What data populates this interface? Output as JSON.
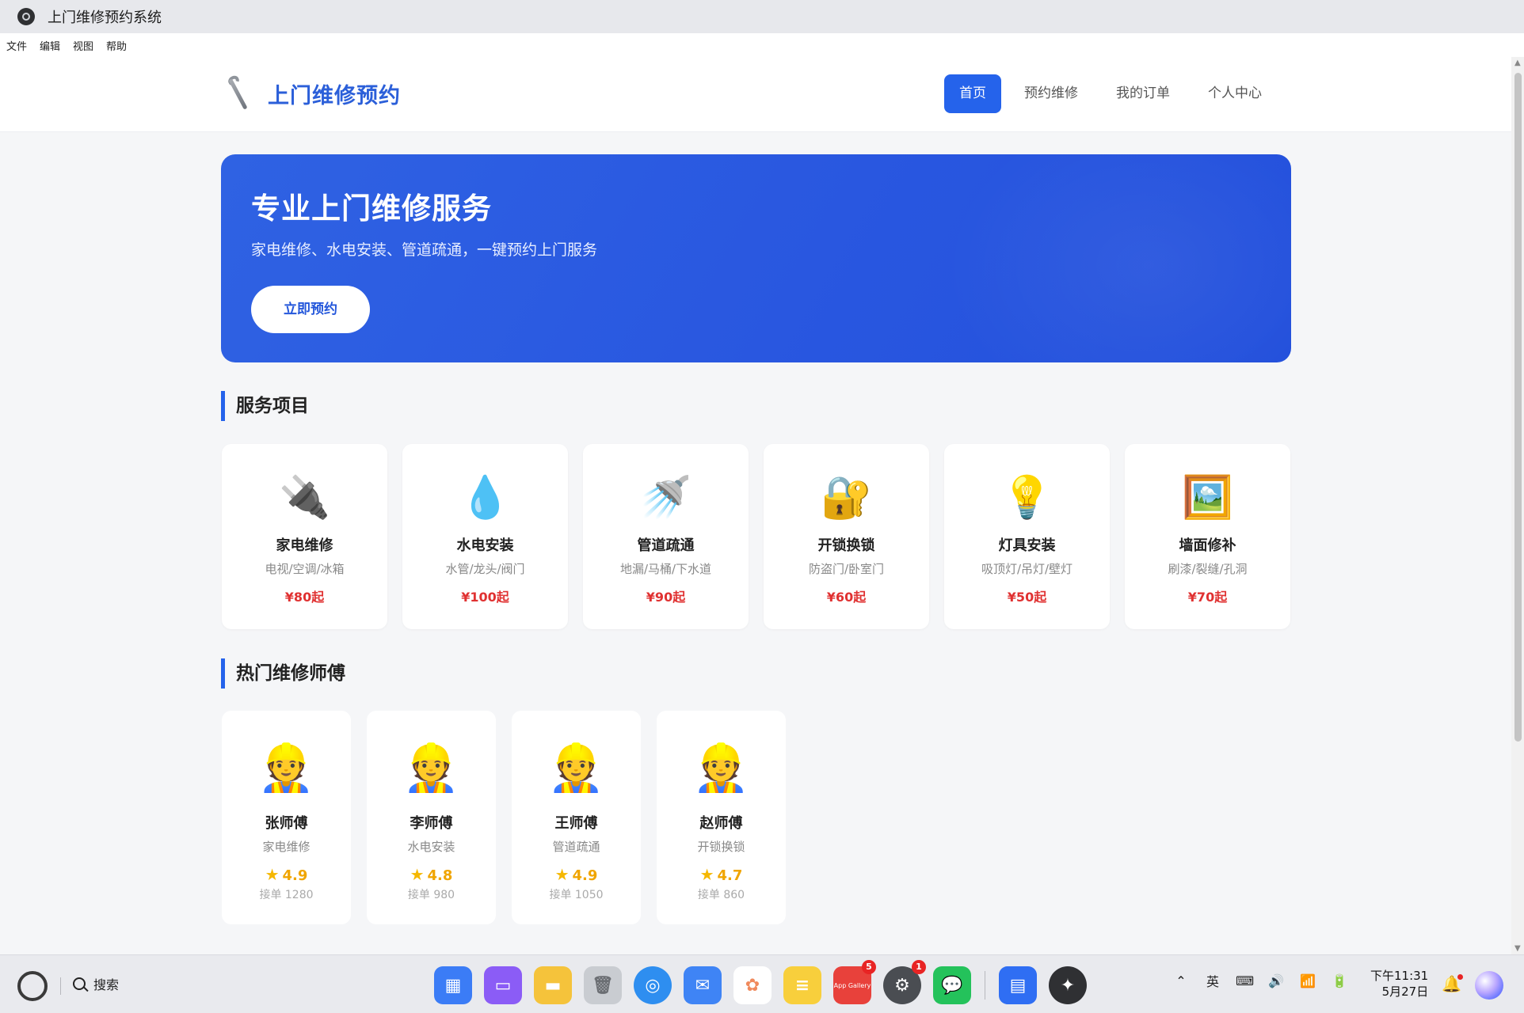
{
  "window": {
    "title": "上门维修预约系统"
  },
  "menubar": [
    "文件",
    "编辑",
    "视图",
    "帮助"
  ],
  "header": {
    "brand": "上门维修预约",
    "nav": [
      "首页",
      "预约维修",
      "我的订单",
      "个人中心"
    ]
  },
  "hero": {
    "title": "专业上门维修服务",
    "subtitle": "家电维修、水电安装、管道疏通，一键预约上门服务",
    "cta": "立即预约"
  },
  "services": {
    "title": "服务项目",
    "items": [
      {
        "icon": "🔌",
        "name": "家电维修",
        "sub": "电视/空调/冰箱",
        "price": "¥80起"
      },
      {
        "icon": "💧",
        "name": "水电安装",
        "sub": "水管/龙头/阀门",
        "price": "¥100起"
      },
      {
        "icon": "🚿",
        "name": "管道疏通",
        "sub": "地漏/马桶/下水道",
        "price": "¥90起"
      },
      {
        "icon": "🔐",
        "name": "开锁换锁",
        "sub": "防盗门/卧室门",
        "price": "¥60起"
      },
      {
        "icon": "💡",
        "name": "灯具安装",
        "sub": "吸顶灯/吊灯/壁灯",
        "price": "¥50起"
      },
      {
        "icon": "🖼️",
        "name": "墙面修补",
        "sub": "刷漆/裂缝/孔洞",
        "price": "¥70起"
      }
    ]
  },
  "masters": {
    "title": "热门维修师傅",
    "items": [
      {
        "avatar": "👷",
        "name": "张师傅",
        "skill": "家电维修",
        "rating": "4.9",
        "orders": "接单 1280"
      },
      {
        "avatar": "👷",
        "name": "李师傅",
        "skill": "水电安装",
        "rating": "4.8",
        "orders": "接单 980"
      },
      {
        "avatar": "👷",
        "name": "王师傅",
        "skill": "管道疏通",
        "rating": "4.9",
        "orders": "接单 1050"
      },
      {
        "avatar": "👷",
        "name": "赵师傅",
        "skill": "开锁换锁",
        "rating": "4.7",
        "orders": "接单 860"
      }
    ]
  },
  "taskbar": {
    "search_label": "搜索",
    "dock": [
      {
        "name": "apps-grid-icon",
        "color": "#3b7cf6",
        "label": ""
      },
      {
        "name": "multitask-icon",
        "color": "#8b5cf6",
        "label": ""
      },
      {
        "name": "files-icon",
        "color": "#f5c33b",
        "label": ""
      },
      {
        "name": "trash-icon",
        "color": "#c9ccd1",
        "label": ""
      },
      {
        "name": "browser-icon",
        "color": "#2e8ef0",
        "label": ""
      },
      {
        "name": "mail-icon",
        "color": "#3f84f5",
        "label": ""
      },
      {
        "name": "photos-icon",
        "color": "#f3a0c2",
        "label": ""
      },
      {
        "name": "notes-icon",
        "color": "#f8cf3c",
        "label": ""
      },
      {
        "name": "app-gallery-icon",
        "color": "#e8413b",
        "label": "App Gallery",
        "badge": "5"
      },
      {
        "name": "settings-icon",
        "color": "#4a4d52",
        "label": "",
        "badge": "1"
      },
      {
        "name": "wechat-icon",
        "color": "#24c25b",
        "label": ""
      },
      {
        "name": "document-icon",
        "color": "#2f6ef3",
        "label": ""
      },
      {
        "name": "ai-assistant-icon",
        "color": "#2f3033",
        "label": ""
      }
    ],
    "tray": {
      "ime": "英"
    },
    "clock": {
      "time": "下午11:31",
      "date": "5月27日"
    }
  },
  "colors": {
    "accent": "#2563eb",
    "price": "#e03131",
    "rating": "#f0a500"
  }
}
